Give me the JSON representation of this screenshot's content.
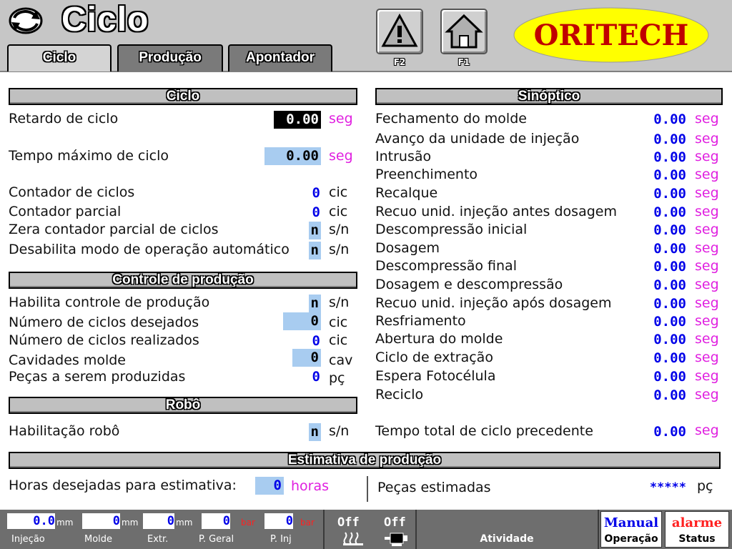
{
  "app": {
    "title": "Ciclo",
    "brand": "ORITECH"
  },
  "tabs": [
    {
      "label": "Ciclo",
      "active": true
    },
    {
      "label": "Produção",
      "active": false
    },
    {
      "label": "Apontador",
      "active": false
    }
  ],
  "function_keys": [
    {
      "label": "F2",
      "icon": "warning-icon"
    },
    {
      "label": "F1",
      "icon": "home-icon"
    }
  ],
  "colors": {
    "accent_blue": "#0000e8",
    "unit_magenta": "#e020e0",
    "field_blue": "#a8ccf0",
    "alarm_red": "#ff2020"
  },
  "ciclo": {
    "title": "Ciclo",
    "retardo": {
      "label": "Retardo de ciclo",
      "value": "0.00",
      "unit": "seg"
    },
    "tempo_max": {
      "label": "Tempo máximo de ciclo",
      "value": "0.00",
      "unit": "seg"
    },
    "contador": {
      "label": "Contador de ciclos",
      "value": "0",
      "unit": "cic"
    },
    "contador_parcial": {
      "label": "Contador parcial",
      "value": "0",
      "unit": "cic"
    },
    "zera": {
      "label": "Zera contador parcial de ciclos",
      "value": "n",
      "unit": "s/n"
    },
    "desabilita": {
      "label": "Desabilita modo de operação automático",
      "value": "n",
      "unit": "s/n"
    }
  },
  "controle": {
    "title": "Controle de produção",
    "habilita": {
      "label": "Habilita controle de produção",
      "value": "n",
      "unit": "s/n"
    },
    "desejados": {
      "label": "Número de ciclos desejados",
      "value": "0",
      "unit": "cic"
    },
    "realizados": {
      "label": "Número de ciclos realizados",
      "value": "0",
      "unit": "cic"
    },
    "cavidades": {
      "label": "Cavidades molde",
      "value": "0",
      "unit": "cav"
    },
    "pecas": {
      "label": "Peças a serem produzidas",
      "value": "0",
      "unit": "pç"
    }
  },
  "robo": {
    "title": "Robô",
    "habilitacao": {
      "label": "Habilitação robô",
      "value": "n",
      "unit": "s/n"
    }
  },
  "sinoptico": {
    "title": "Sinóptico",
    "unit": "seg",
    "rows": [
      {
        "label": "Fechamento do molde",
        "value": "0.00"
      },
      {
        "label": "Avanço da unidade de injeção",
        "value": "0.00"
      },
      {
        "label": "Intrusão",
        "value": "0.00"
      },
      {
        "label": "Preenchimento",
        "value": "0.00"
      },
      {
        "label": "Recalque",
        "value": "0.00"
      },
      {
        "label": "Recuo unid. injeção antes dosagem",
        "value": "0.00"
      },
      {
        "label": "Descompressão inicial",
        "value": "0.00"
      },
      {
        "label": "Dosagem",
        "value": "0.00"
      },
      {
        "label": "Descompressão final",
        "value": "0.00"
      },
      {
        "label": "Dosagem e descompressão",
        "value": "0.00"
      },
      {
        "label": "Recuo unid. injeção após dosagem",
        "value": "0.00"
      },
      {
        "label": "Resfriamento",
        "value": "0.00"
      },
      {
        "label": "Abertura do molde",
        "value": "0.00"
      },
      {
        "label": "Ciclo de extração",
        "value": "0.00"
      },
      {
        "label": "Espera Fotocélula",
        "value": "0.00"
      },
      {
        "label": "Reciclo",
        "value": "0.00"
      }
    ],
    "total": {
      "label": "Tempo total de ciclo precedente",
      "value": "0.00"
    }
  },
  "estimativa": {
    "title": "Estimativa de produção",
    "horas_label": "Horas desejadas para estimativa:",
    "horas_value": "0",
    "horas_unit": "horas",
    "pecas_label": "Peças estimadas",
    "pecas_value": "*****",
    "pecas_unit": "pç"
  },
  "statusbar": {
    "injecao": {
      "value": "0.0",
      "unit": "mm",
      "caption": "Injeção"
    },
    "molde": {
      "value": "0",
      "unit": "mm",
      "caption": "Molde"
    },
    "extr": {
      "value": "0",
      "unit": "mm",
      "caption": "Extr."
    },
    "p_geral": {
      "value": "0",
      "unit": "bar",
      "caption": "P. Geral"
    },
    "p_inj": {
      "value": "0",
      "unit": "bar",
      "caption": "P. Inj"
    },
    "heater": {
      "state": "Off",
      "icon": "heater-icon"
    },
    "motor": {
      "state": "Off",
      "icon": "motor-icon"
    },
    "atividade": "Atividade",
    "operacao": {
      "mode": "Manual",
      "caption": "Operação"
    },
    "status": {
      "state": "alarme",
      "caption": "Status"
    }
  }
}
